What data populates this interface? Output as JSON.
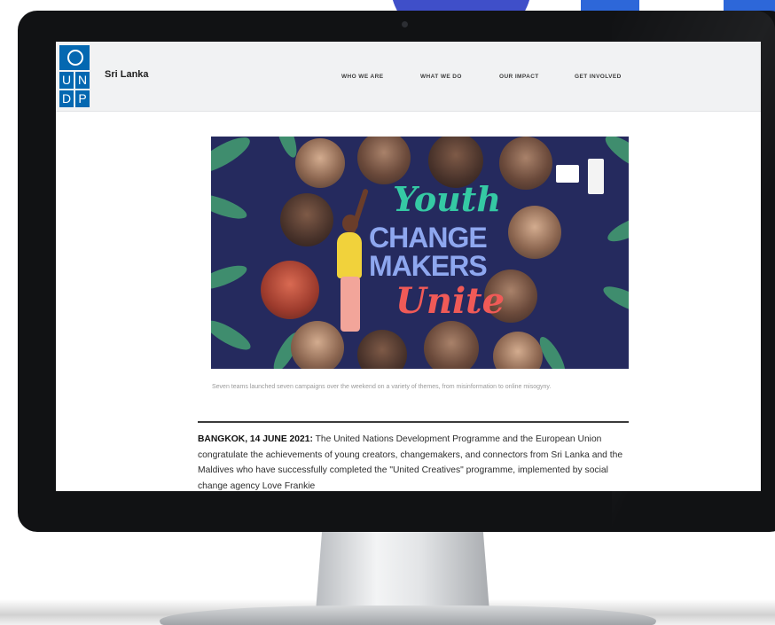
{
  "site": {
    "logo_letters": [
      "U",
      "N",
      "D",
      "P"
    ],
    "name": "Sri Lanka"
  },
  "nav": {
    "items": [
      "WHO WE ARE",
      "WHAT WE DO",
      "OUR IMPACT",
      "GET INVOLVED"
    ]
  },
  "hero": {
    "line1": "Youth",
    "line2": "CHANGE",
    "line3": "MAKERS",
    "line4": "Unite"
  },
  "caption": "Seven teams launched seven campaigns over the weekend on a variety of themes, from misinformation to online misogyny.",
  "article": {
    "dateline": "BANGKOK, 14 JUNE 2021:",
    "body": "The United Nations Development Programme and the European Union congratulate the achievements of young creators, changemakers, and connectors from Sri Lanka and the Maldives who have successfully completed the \"United Creatives\" programme, implemented by social change agency Love Frankie"
  },
  "colors": {
    "undp_blue": "#0468b1",
    "hero_bg": "#252a5e",
    "youth_green": "#35c9a4",
    "changemakers_blue": "#8ea7ef",
    "unite_red": "#f05a57"
  }
}
